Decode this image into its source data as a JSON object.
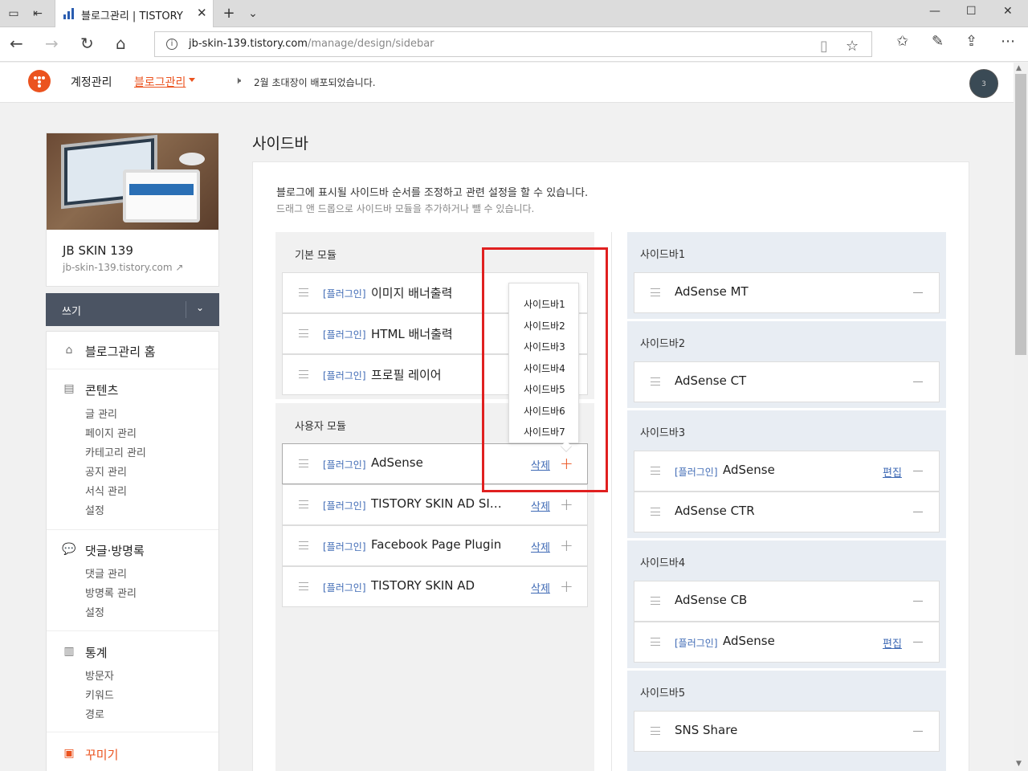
{
  "browser": {
    "tab_title": "블로그관리 | TISTORY",
    "url_host": "jb-skin-139.tistory.com",
    "url_path": "/manage/design/sidebar",
    "url_info": "i"
  },
  "topnav": {
    "account": "계정관리",
    "blog_manage": "블로그관리",
    "notice": "2월 초대장이 배포되었습니다.",
    "avatar_count": "3"
  },
  "blog": {
    "title": "JB SKIN 139",
    "url": "jb-skin-139.tistory.com",
    "external_icon": "↗"
  },
  "write": {
    "label": "쓰기",
    "chevron": "⌄"
  },
  "menu": {
    "home": "블로그관리 홈",
    "contents": {
      "title": "콘텐츠",
      "items": [
        "글 관리",
        "페이지 관리",
        "카테고리 관리",
        "공지 관리",
        "서식 관리",
        "설정"
      ]
    },
    "comments": {
      "title": "댓글·방명록",
      "items": [
        "댓글 관리",
        "방명록 관리",
        "설정"
      ]
    },
    "stats": {
      "title": "통계",
      "items": [
        "방문자",
        "키워드",
        "경로"
      ]
    },
    "decorate": {
      "title": "꾸미기"
    }
  },
  "main": {
    "title": "사이드바",
    "desc1": "블로그에 표시될 사이드바 순서를 조정하고 관련 설정을 할 수 있습니다.",
    "desc2": "드래그 앤 드롭으로 사이드바 모듈을 추가하거나 뺄 수 있습니다."
  },
  "basic_modules": {
    "title": "기본 모듈",
    "items": [
      {
        "tag": "[플러그인]",
        "name": "이미지 배너출력"
      },
      {
        "tag": "[플러그인]",
        "name": "HTML 배너출력"
      },
      {
        "tag": "[플러그인]",
        "name": "프로필 레이어"
      }
    ]
  },
  "user_modules": {
    "title": "사용자 모듈",
    "delete_label": "삭제",
    "add_label": "+",
    "items": [
      {
        "tag": "[플러그인]",
        "name": "AdSense"
      },
      {
        "tag": "[플러그인]",
        "name": "TISTORY SKIN AD SI…"
      },
      {
        "tag": "[플러그인]",
        "name": "Facebook Page Plugin"
      },
      {
        "tag": "[플러그인]",
        "name": "TISTORY SKIN AD"
      }
    ]
  },
  "dropdown": {
    "items": [
      "사이드바1",
      "사이드바2",
      "사이드바3",
      "사이드바4",
      "사이드바5",
      "사이드바6",
      "사이드바7"
    ]
  },
  "sidebars": {
    "edit_label": "편집",
    "groups": [
      {
        "title": "사이드바1",
        "items": [
          {
            "tag": "",
            "name": "AdSense MT"
          }
        ]
      },
      {
        "title": "사이드바2",
        "items": [
          {
            "tag": "",
            "name": "AdSense CT"
          }
        ]
      },
      {
        "title": "사이드바3",
        "items": [
          {
            "tag": "[플러그인]",
            "name": "AdSense"
          },
          {
            "tag": "",
            "name": "AdSense CTR"
          }
        ]
      },
      {
        "title": "사이드바4",
        "items": [
          {
            "tag": "",
            "name": "AdSense CB"
          },
          {
            "tag": "[플러그인]",
            "name": "AdSense"
          }
        ]
      },
      {
        "title": "사이드바5",
        "items": [
          {
            "tag": "",
            "name": "SNS Share"
          }
        ]
      }
    ]
  },
  "colors": {
    "accent": "#eb531f",
    "link": "#3f6ab5",
    "highlight": "#e02020",
    "write_bg": "#4b5463"
  }
}
